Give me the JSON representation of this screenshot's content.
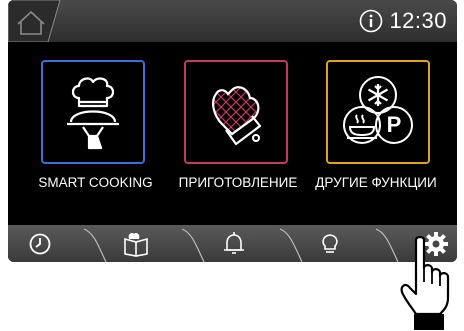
{
  "status": {
    "time": "12:30"
  },
  "icons": {
    "home": "home-icon",
    "info": "info-icon",
    "chef": "chef-cloche-icon",
    "mitt": "oven-mitt-icon",
    "functions": "snowflake-steam-p-icon",
    "timer": "clock-icon",
    "recipes": "recipe-book-icon",
    "bell": "bell-icon",
    "light": "lightbulb-icon",
    "settings": "gear-icon",
    "hand": "pointing-hand-icon"
  },
  "tiles": [
    {
      "label": "SMART COOKING",
      "color": "#3a6fd8"
    },
    {
      "label": "ПРИГОТОВЛЕНИЕ",
      "color": "#c43a5c"
    },
    {
      "label": "ДРУГИЕ ФУНКЦИИ",
      "color": "#e0a21e"
    }
  ]
}
